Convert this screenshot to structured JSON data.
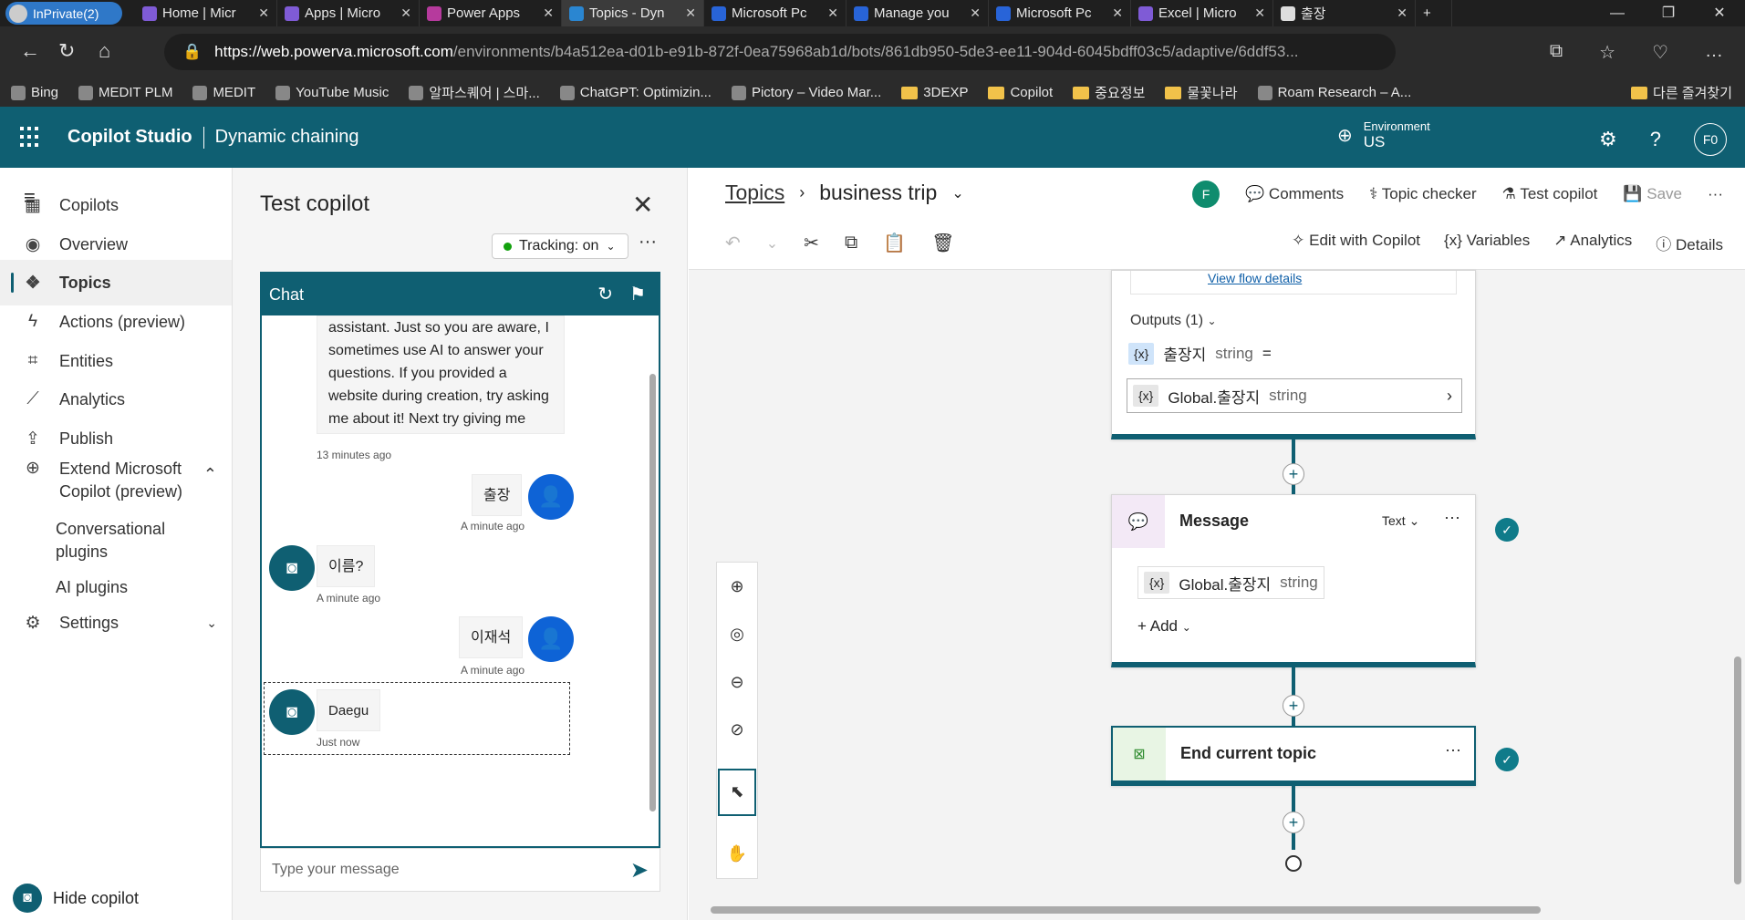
{
  "browser": {
    "profile": "InPrivate(2)",
    "tabs": [
      {
        "title": "Home | Micr",
        "color": "#7f5bd6"
      },
      {
        "title": "Apps | Micro",
        "color": "#7f5bd6"
      },
      {
        "title": "Power Apps",
        "color": "#b63a9d"
      },
      {
        "title": "Topics - Dyn",
        "color": "#2a86d1",
        "active": true
      },
      {
        "title": "Microsoft Pc",
        "color": "#2864d8"
      },
      {
        "title": "Manage you",
        "color": "#2864d8"
      },
      {
        "title": "Microsoft Pc",
        "color": "#2864d8"
      },
      {
        "title": "Excel | Micro",
        "color": "#7f5bd6"
      },
      {
        "title": "출장",
        "color": "#dddddd"
      }
    ],
    "url_host": "https://web.powerva.microsoft.com",
    "url_path": "/environments/b4a512ea-d01b-e91b-872f-0ea75968ab1d/bots/861db950-5de3-ee11-904d-6045bdff03c5/adaptive/6ddf53...",
    "bookmarks": [
      {
        "label": "Bing",
        "icon": "bing-icon"
      },
      {
        "label": "MEDIT PLM",
        "icon": "medit-icon"
      },
      {
        "label": "MEDIT",
        "icon": "medit-icon"
      },
      {
        "label": "YouTube Music",
        "icon": "youtube-icon"
      },
      {
        "label": "알파스퀘어 | 스마...",
        "icon": "alpha-icon"
      },
      {
        "label": "ChatGPT: Optimizin...",
        "icon": "chatgpt-icon"
      },
      {
        "label": "Pictory – Video Mar...",
        "icon": "pictory-icon"
      },
      {
        "label": "3DEXP",
        "icon": "folder-icon"
      },
      {
        "label": "Copilot",
        "icon": "folder-icon"
      },
      {
        "label": "중요정보",
        "icon": "folder-icon"
      },
      {
        "label": "물꽃나라",
        "icon": "folder-icon"
      },
      {
        "label": "Roam Research – A...",
        "icon": "roam-icon"
      }
    ],
    "other_favorites": "다른 즐겨찾기"
  },
  "app": {
    "name": "Copilot Studio",
    "bot": "Dynamic chaining",
    "env_label": "Environment",
    "env_value": "US",
    "user_initials": "F0",
    "accent": "#0f5f72"
  },
  "nav": {
    "items": [
      {
        "label": "Copilots",
        "icon": "copilots-icon"
      },
      {
        "label": "Overview",
        "icon": "overview-icon"
      },
      {
        "label": "Topics",
        "icon": "topics-icon",
        "active": true
      },
      {
        "label": "Actions (preview)",
        "icon": "actions-icon"
      },
      {
        "label": "Entities",
        "icon": "entities-icon"
      },
      {
        "label": "Analytics",
        "icon": "analytics-icon"
      },
      {
        "label": "Publish",
        "icon": "publish-icon"
      },
      {
        "label": "Extend Microsoft Copilot (preview)",
        "icon": "extend-icon"
      }
    ],
    "sub": [
      "Conversational plugins",
      "AI plugins"
    ],
    "settings": "Settings",
    "hide_copilot": "Hide copilot"
  },
  "test": {
    "title": "Test copilot",
    "tracking": "Tracking: on",
    "chat_label": "Chat",
    "messages": {
      "bot1": "assistant. Just so you are aware, I sometimes use AI to answer your questions. If you provided a website during creation, try asking me about it! Next try giving me some more knowledge by setting up generative AI.",
      "bot1_time": "13 minutes ago",
      "user1": "출장",
      "user1_time": "A minute ago",
      "bot2": "이름?",
      "bot2_time": "A minute ago",
      "user2": "이재석",
      "user2_time": "A minute ago",
      "bot3": "Daegu",
      "bot3_time": "Just now"
    },
    "input_placeholder": "Type your message"
  },
  "canvas": {
    "crumb_root": "Topics",
    "topic": "business trip",
    "fav_initial": "F",
    "actions": {
      "comments": "Comments",
      "checker": "Topic checker",
      "test": "Test copilot",
      "save": "Save"
    },
    "tools_r": {
      "edit": "Edit with Copilot",
      "variables": "Variables",
      "analytics": "Analytics",
      "details": "Details"
    },
    "flow_link": "View flow details",
    "outputs": "Outputs (1)",
    "out_var": "출장지",
    "out_type": "string",
    "eq": "=",
    "global_var": "Global.출장지",
    "global_type": "string",
    "message_title": "Message",
    "message_mode": "Text",
    "msg_var": "Global.출장지",
    "msg_type": "string",
    "add": "Add",
    "end_title": "End current topic"
  }
}
